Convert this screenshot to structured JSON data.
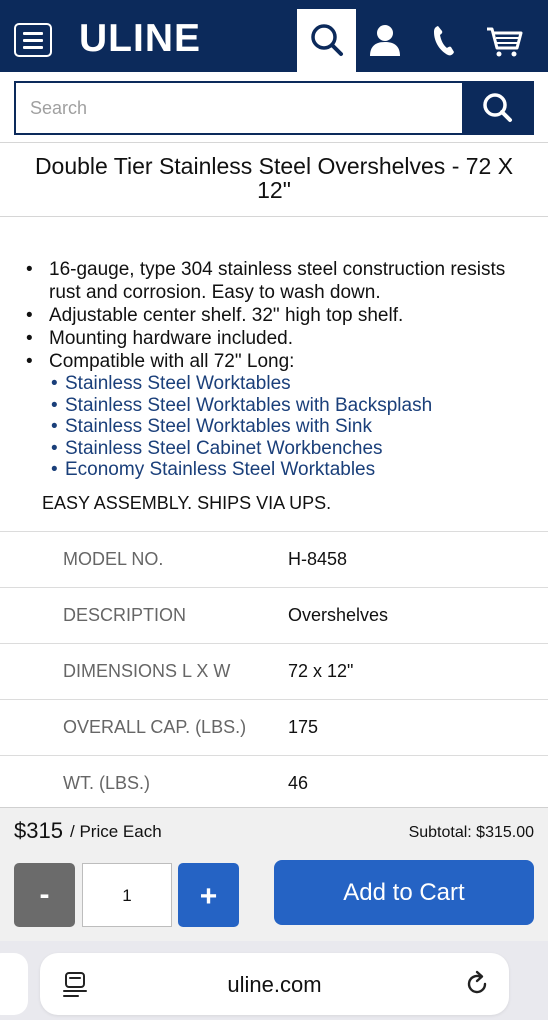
{
  "header": {
    "logo": "ULINE",
    "icons": [
      "menu-icon",
      "search-icon",
      "user-icon",
      "phone-icon",
      "cart-icon"
    ]
  },
  "search": {
    "placeholder": "Search"
  },
  "product": {
    "title": "Double Tier Stainless Steel Overshelves - 72 X 12\"",
    "bullets": [
      "16-gauge, type 304 stainless steel construction resists rust and corrosion. Easy to wash down.",
      "Adjustable center shelf. 32\" high top shelf.",
      "Mounting hardware included.",
      "Compatible with all 72\" Long:"
    ],
    "compatible_links": [
      "Stainless Steel Worktables",
      "Stainless Steel Worktables with Backsplash",
      "Stainless Steel Worktables with Sink",
      "Stainless Steel Cabinet Workbenches",
      "Economy Stainless Steel Worktables"
    ],
    "note": "EASY ASSEMBLY. SHIPS VIA UPS."
  },
  "specs": [
    {
      "label": "MODEL NO.",
      "value": "H-8458"
    },
    {
      "label": "DESCRIPTION",
      "value": "Overshelves"
    },
    {
      "label": "DIMENSIONS L X W",
      "value": "72 x 12\""
    },
    {
      "label": "OVERALL CAP. (LBS.)",
      "value": "175"
    },
    {
      "label": "WT. (LBS.)",
      "value": "46"
    }
  ],
  "purchase": {
    "price": "$315",
    "price_suffix": "/ Price Each",
    "subtotal": "Subtotal: $315.00",
    "minus_label": "-",
    "quantity": "1",
    "plus_label": "+",
    "add_to_cart": "Add to Cart"
  },
  "browser": {
    "url": "uline.com"
  },
  "colors": {
    "brand_navy": "#0c2a5b",
    "button_blue": "#2563c4",
    "link_blue": "#1a3f7a",
    "minus_gray": "#6b6b6b"
  }
}
